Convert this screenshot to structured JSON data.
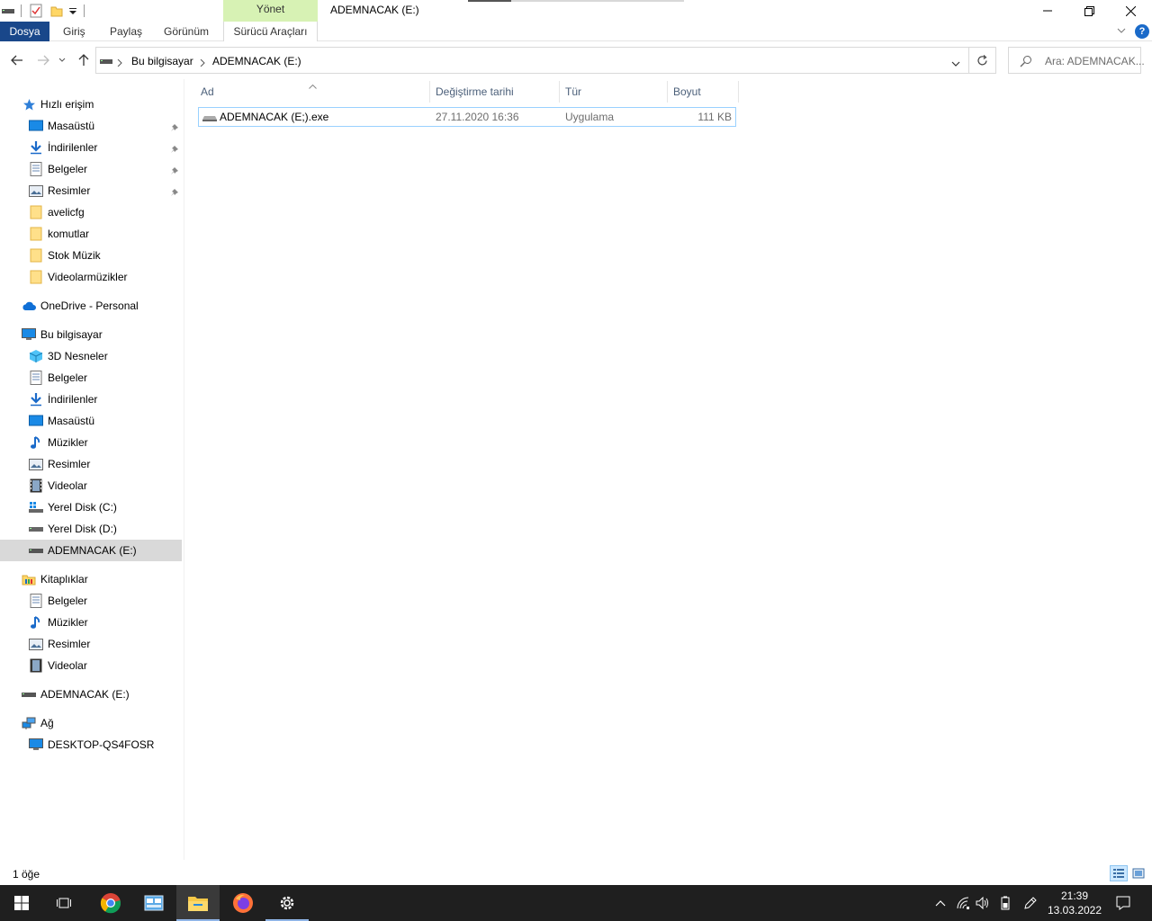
{
  "window": {
    "title": "ADEMNACAK (E:)",
    "context_tab_group": "Yönet"
  },
  "ribbon": {
    "tabs": [
      "Dosya",
      "Giriş",
      "Paylaş",
      "Görünüm",
      "Sürücü Araçları"
    ]
  },
  "address": {
    "breadcrumb": [
      "Bu bilgisayar",
      "ADEMNACAK (E:)"
    ],
    "search_placeholder": "Ara: ADEMNACAK..."
  },
  "sidebar": {
    "quick_access": {
      "label": "Hızlı erişim",
      "items": [
        {
          "label": "Masaüstü",
          "icon": "desktop-icon",
          "pinned": true
        },
        {
          "label": "İndirilenler",
          "icon": "download-icon",
          "pinned": true
        },
        {
          "label": "Belgeler",
          "icon": "documents-icon",
          "pinned": true
        },
        {
          "label": "Resimler",
          "icon": "pictures-icon",
          "pinned": true
        },
        {
          "label": "avelicfg",
          "icon": "folder-icon",
          "pinned": false
        },
        {
          "label": "komutlar",
          "icon": "folder-icon",
          "pinned": false
        },
        {
          "label": "Stok Müzik",
          "icon": "folder-icon",
          "pinned": false
        },
        {
          "label": "Videolarmüzikler",
          "icon": "folder-icon",
          "pinned": false
        }
      ]
    },
    "onedrive": {
      "label": "OneDrive - Personal"
    },
    "this_pc": {
      "label": "Bu bilgisayar",
      "items": [
        {
          "label": "3D Nesneler",
          "icon": "3d-objects-icon"
        },
        {
          "label": "Belgeler",
          "icon": "documents-icon"
        },
        {
          "label": "İndirilenler",
          "icon": "download-icon"
        },
        {
          "label": "Masaüstü",
          "icon": "desktop-icon"
        },
        {
          "label": "Müzikler",
          "icon": "music-icon"
        },
        {
          "label": "Resimler",
          "icon": "pictures-icon"
        },
        {
          "label": "Videolar",
          "icon": "videos-icon"
        },
        {
          "label": "Yerel Disk (C:)",
          "icon": "windows-drive-icon"
        },
        {
          "label": "Yerel Disk (D:)",
          "icon": "drive-icon"
        },
        {
          "label": "ADEMNACAK (E:)",
          "icon": "usb-drive-icon",
          "selected": true
        }
      ]
    },
    "libraries": {
      "label": "Kitaplıklar",
      "items": [
        {
          "label": "Belgeler",
          "icon": "documents-icon"
        },
        {
          "label": "Müzikler",
          "icon": "music-icon"
        },
        {
          "label": "Resimler",
          "icon": "pictures-icon"
        },
        {
          "label": "Videolar",
          "icon": "videos-icon"
        }
      ]
    },
    "removable": {
      "label": "ADEMNACAK (E:)"
    },
    "network": {
      "label": "Ağ",
      "items": [
        {
          "label": "DESKTOP-QS4FOSR",
          "icon": "computer-icon"
        }
      ]
    }
  },
  "file_list": {
    "columns": [
      "Ad",
      "Değiştirme tarihi",
      "Tür",
      "Boyut"
    ],
    "rows": [
      {
        "name": "ADEMNACAK (E;).exe",
        "modified": "27.11.2020 16:36",
        "type": "Uygulama",
        "size": "111 KB"
      }
    ]
  },
  "status": {
    "item_count": "1 öğe"
  },
  "taskbar": {
    "time": "21:39",
    "date": "13.03.2022"
  },
  "colors": {
    "dosya_tab": "#19478a",
    "manage_tab": "#d7f2b4",
    "selection_border": "#99d1ff",
    "taskbar": "#1f1f1f"
  }
}
